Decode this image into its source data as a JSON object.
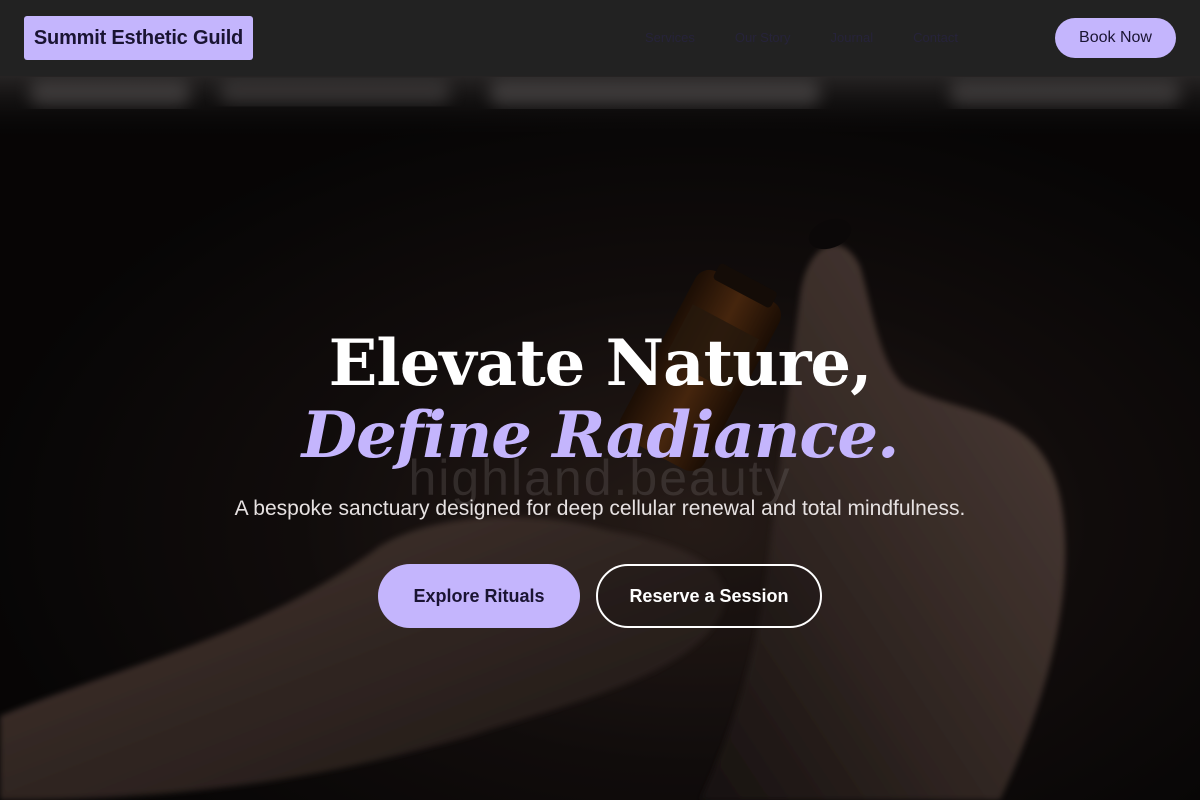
{
  "header": {
    "brand": "Summit Esthetic Guild",
    "nav": [
      "Services",
      "Our Story",
      "Journal",
      "Contact"
    ],
    "cta": "Book Now"
  },
  "hero": {
    "title_line1": "Elevate Nature,",
    "title_line2": "Define Radiance.",
    "watermark": "highland.beauty",
    "tagline": "A bespoke sanctuary designed for deep cellular renewal and total mindfulness.",
    "primary_button": "Explore Rituals",
    "secondary_button": "Reserve a Session"
  },
  "colors": {
    "accent": "#c4b5fd",
    "header_bg": "#222222",
    "text_light": "#ffffff"
  }
}
